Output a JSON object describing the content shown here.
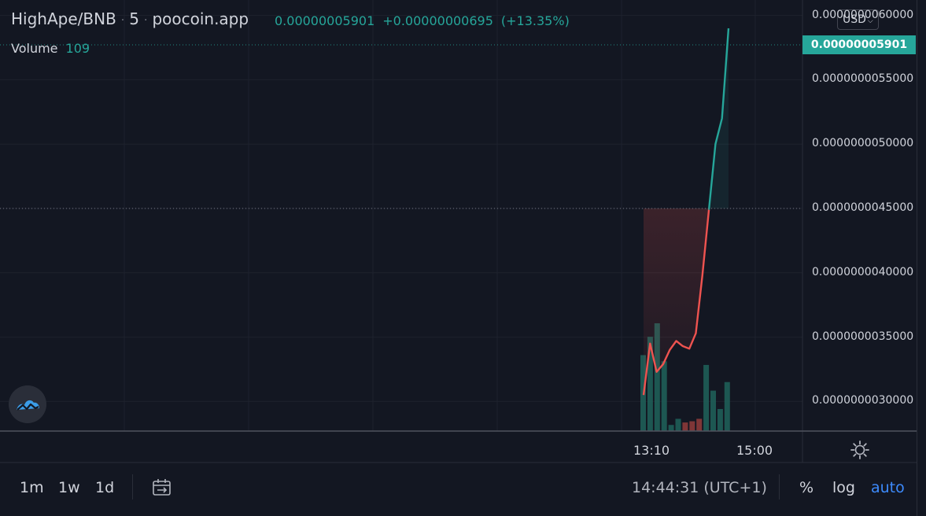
{
  "header": {
    "pair": "HighApe/BNB",
    "interval": "5",
    "source": "poocoin.app",
    "price": "0.00000005901",
    "change": "+0.00000000695",
    "change_pct": "(+13.35%)",
    "dot": "·"
  },
  "volume": {
    "label": "Volume",
    "value": "109"
  },
  "currency": {
    "label": "USD"
  },
  "price_tag": "0.00000005901",
  "colors": {
    "background": "#131722",
    "up": "#26a69a",
    "down": "#ef5350",
    "grid": "#1e222d",
    "accent": "#3d8bfd"
  },
  "icons": [
    "logo-icon",
    "gear-icon",
    "date-range-icon",
    "chevron-down-icon"
  ],
  "chart_data": {
    "type": "line",
    "x_ticks": [
      "13:10",
      "15:00"
    ],
    "y_ticks": [
      "0.0000000060000",
      "0.0000000055000",
      "0.0000000050000",
      "0.0000000045000",
      "0.0000000040000",
      "0.0000000035000",
      "0.0000000030000"
    ],
    "y_tick_values": [
      6e-09,
      5.5e-09,
      5e-09,
      4.5e-09,
      4e-09,
      3.5e-09,
      3e-09
    ],
    "ylim": [
      2.77e-09,
      6.12e-09
    ],
    "baseline": 4.5e-09,
    "last_price": 5.901e-08,
    "grid": true,
    "series": [
      {
        "values": [
          3.05e-09,
          3.45e-09,
          3.23e-09,
          3.29e-09,
          3.4e-09,
          3.47e-09,
          3.43e-09,
          3.41e-09,
          3.53e-09,
          3.98e-09,
          4.49e-09,
          5e-09,
          5.2e-09,
          5.9e-09
        ]
      }
    ],
    "volume": {
      "values": [
        62,
        77,
        88,
        57,
        5,
        10,
        7,
        8,
        10,
        54,
        33,
        18,
        40
      ],
      "colors": [
        "up",
        "up",
        "up",
        "up",
        "up",
        "up",
        "down",
        "down",
        "down",
        "up",
        "up",
        "up",
        "up"
      ]
    }
  },
  "timeframes": [
    "1m",
    "1w",
    "1d"
  ],
  "clock": "14:44:31 (UTC+1)",
  "options": {
    "percent": "%",
    "log": "log",
    "auto": "auto"
  }
}
